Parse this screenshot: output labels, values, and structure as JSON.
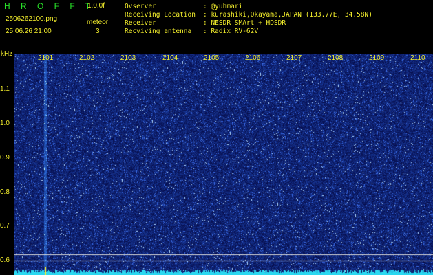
{
  "header": {
    "brand": "H R O F F T",
    "version": "1.0.0f",
    "filename": "2506262100.png",
    "mode": "meteor",
    "timestamp": "25.06.26 21:00",
    "count": "3"
  },
  "info": [
    {
      "label": "Ovserver",
      "value": ": @yuhmari"
    },
    {
      "label": "Receiving Location",
      "value": ": kurashiki,Okayama,JAPAN (133.77E, 34.58N)"
    },
    {
      "label": "Receiver",
      "value": ": NESDR SMArt + HDSDR"
    },
    {
      "label": "Recviving antenna",
      "value": ": Radix RV-62V"
    }
  ],
  "spectrogram": {
    "time_ticks": [
      "2101",
      "2102",
      "2103",
      "2104",
      "2105",
      "2106",
      "2107",
      "2108",
      "2109",
      "2110"
    ],
    "freq_unit": "kHz",
    "freq_ticks": [
      "1.1",
      "1.0",
      "0.9",
      "0.8",
      "0.7",
      "0.6"
    ],
    "freq_range_khz": [
      0.57,
      1.2
    ],
    "colors": {
      "background": "#0a1a6a",
      "noise": "#3a5ad0",
      "baseline": "#2ad8f0",
      "marker": "#f4ef2c",
      "grid": "#e0e0e0"
    }
  }
}
